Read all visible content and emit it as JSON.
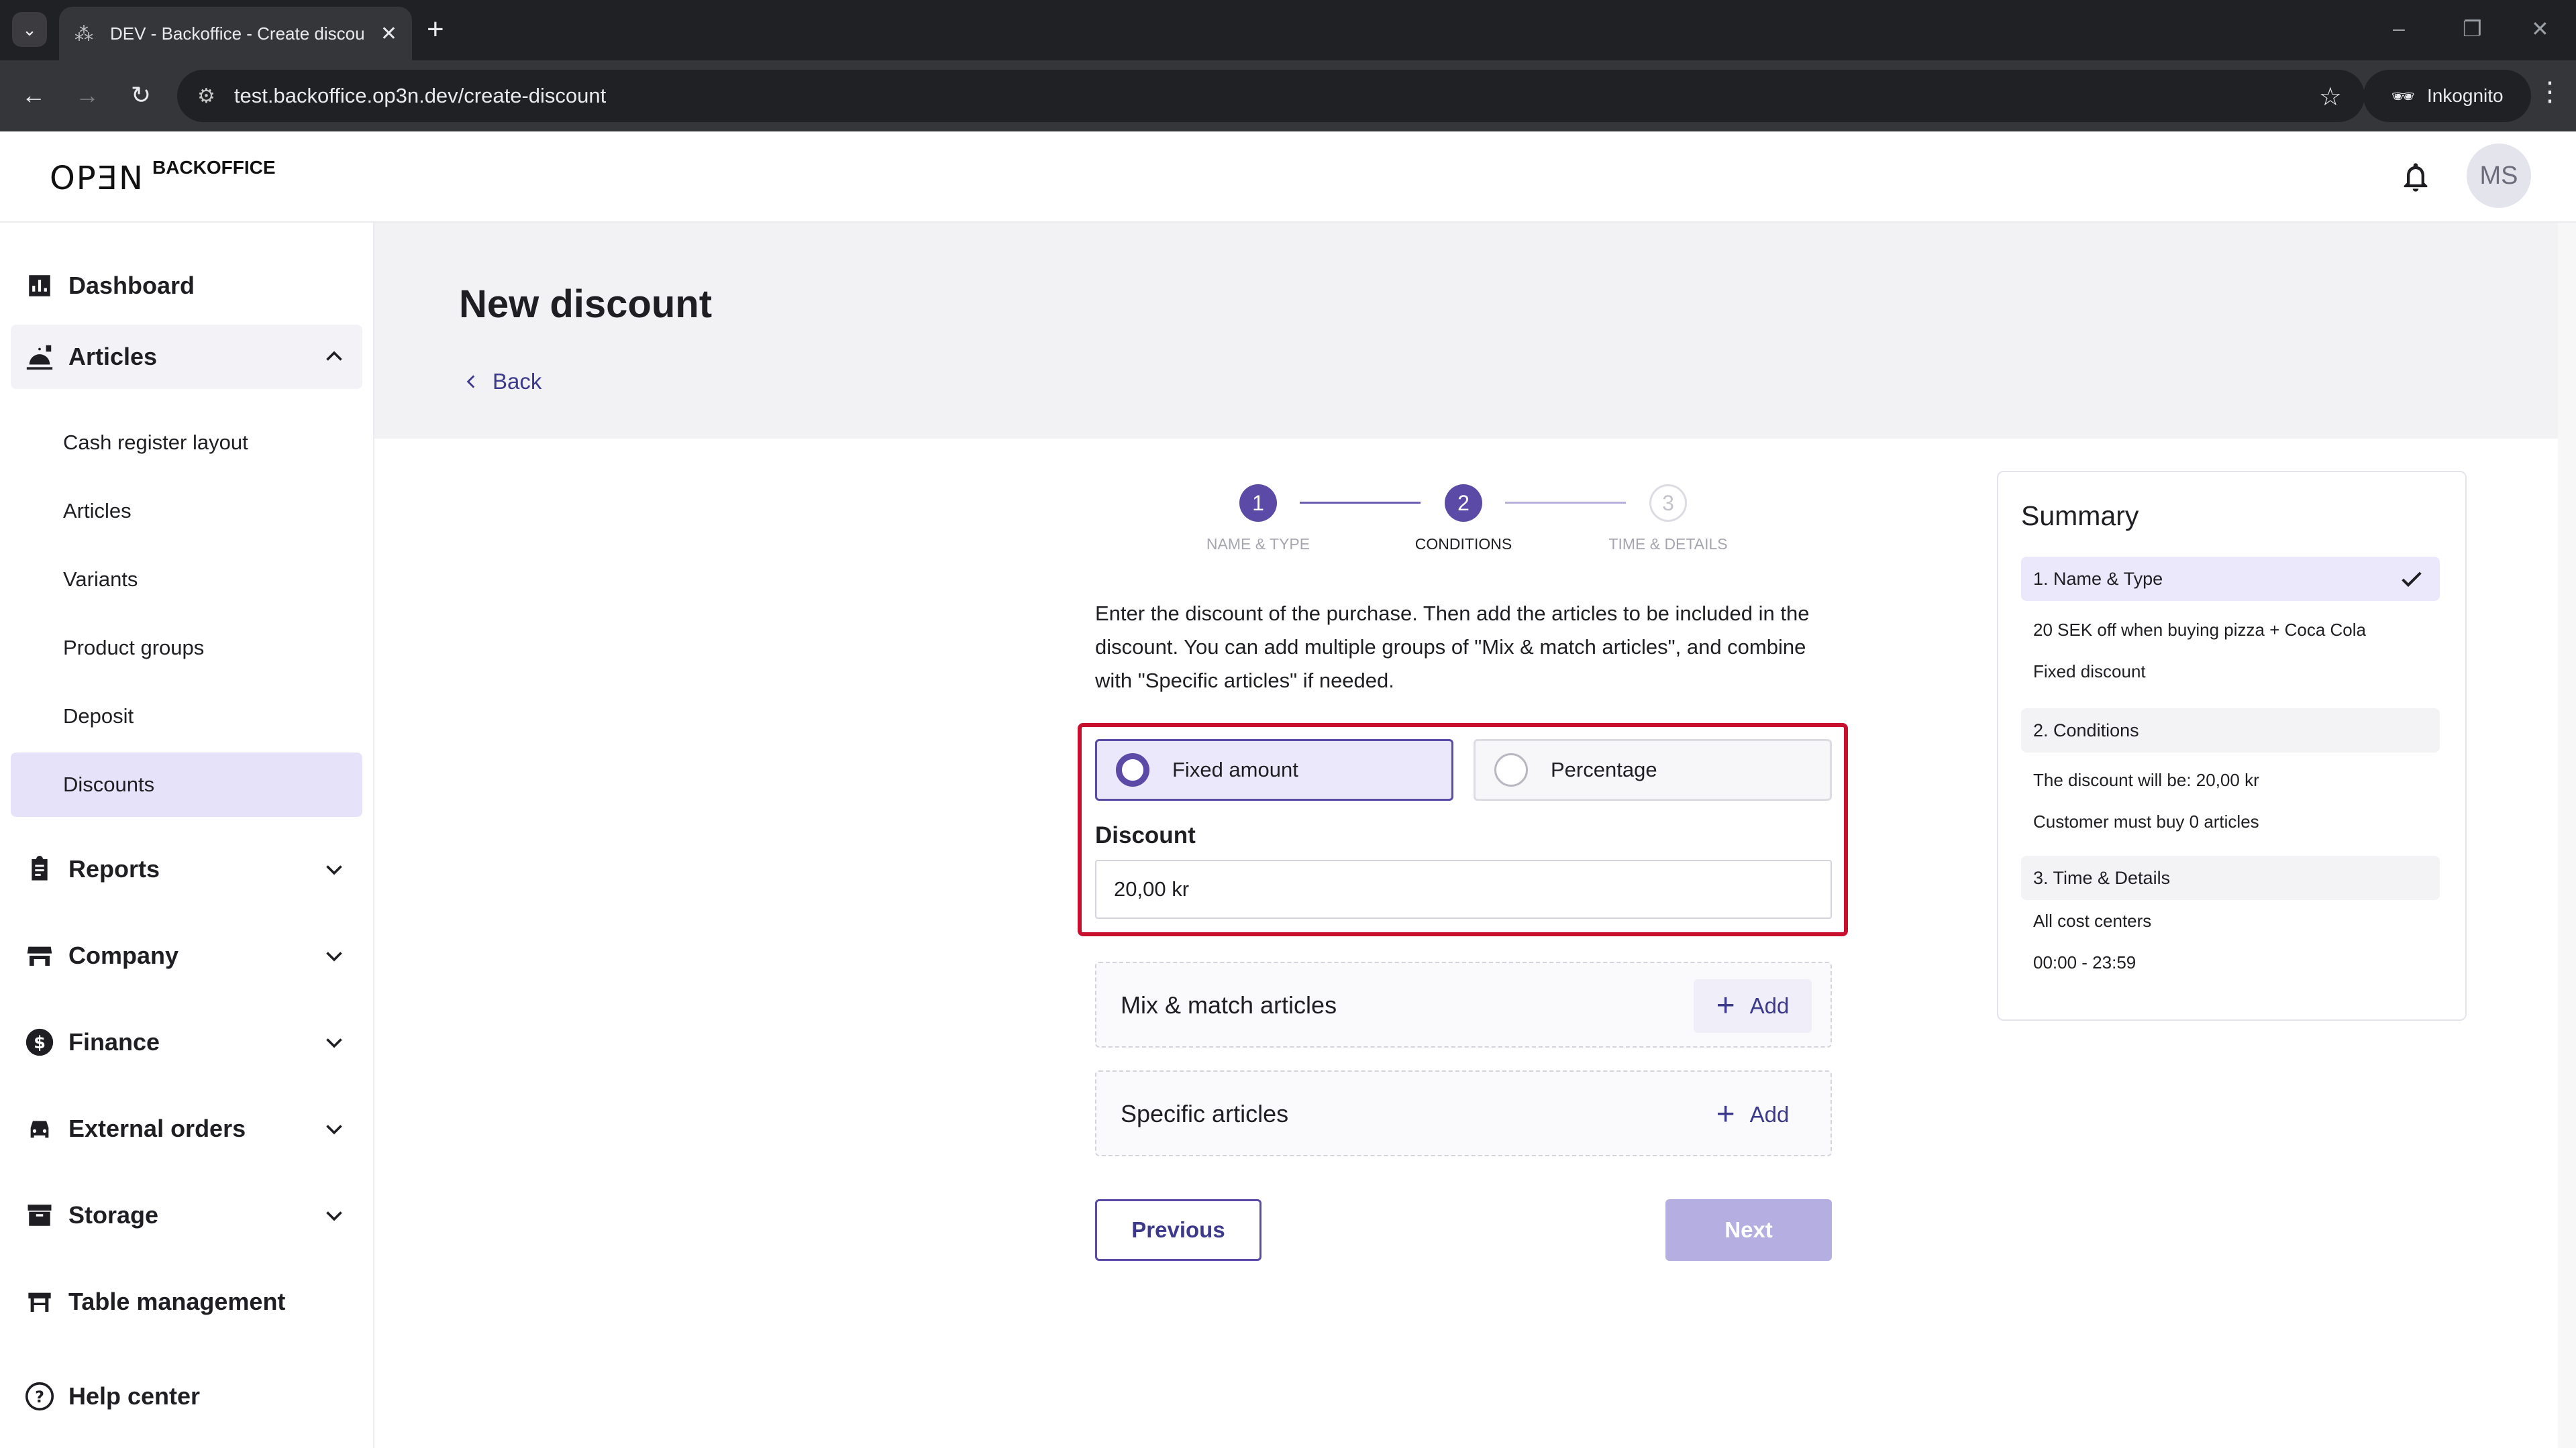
{
  "browser": {
    "tab_title": "DEV - Backoffice - Create discou",
    "url": "test.backoffice.op3n.dev/create-discount",
    "incognito_label": "Inkognito"
  },
  "header": {
    "logo_mark": "OPƎN",
    "logo_text": "BACKOFFICE",
    "avatar_initials": "MS"
  },
  "sidebar": {
    "items": [
      {
        "label": "Dashboard",
        "icon": "bar-chart-icon"
      },
      {
        "label": "Articles",
        "icon": "food-icon"
      },
      {
        "label": "Reports",
        "icon": "clipboard-icon"
      },
      {
        "label": "Company",
        "icon": "store-icon"
      },
      {
        "label": "Finance",
        "icon": "dollar-icon"
      },
      {
        "label": "External orders",
        "icon": "car-icon"
      },
      {
        "label": "Storage",
        "icon": "archive-icon"
      },
      {
        "label": "Table management",
        "icon": "table-icon"
      },
      {
        "label": "Help center",
        "icon": "help-icon"
      }
    ],
    "articles_sub": [
      "Cash register layout",
      "Articles",
      "Variants",
      "Product groups",
      "Deposit",
      "Discounts"
    ]
  },
  "page": {
    "title": "New discount",
    "back_label": "Back"
  },
  "stepper": {
    "steps": [
      {
        "number": "1",
        "label": "NAME & TYPE"
      },
      {
        "number": "2",
        "label": "CONDITIONS"
      },
      {
        "number": "3",
        "label": "TIME & DETAILS"
      }
    ]
  },
  "form": {
    "intro": "Enter the discount of the purchase. Then add the articles to be included in the discount. You can add multiple groups of \"Mix & match articles\", and combine with \"Specific articles\" if needed.",
    "option_fixed": "Fixed amount",
    "option_percentage": "Percentage",
    "discount_label": "Discount",
    "discount_value": "20,00 kr",
    "mix_match_title": "Mix & match articles",
    "specific_title": "Specific articles",
    "add_label": "Add",
    "previous_label": "Previous",
    "next_label": "Next"
  },
  "summary": {
    "title": "Summary",
    "section1_header": "1. Name & Type",
    "section1_lines": [
      "20 SEK off when buying pizza + Coca Cola",
      "Fixed discount"
    ],
    "section2_header": "2. Conditions",
    "section2_lines": [
      "The discount will be: 20,00 kr",
      "Customer must buy 0 articles"
    ],
    "section3_header": "3. Time & Details",
    "section3_lines": [
      "All cost centers",
      "00:00 - 23:59"
    ]
  },
  "colors": {
    "accent": "#5b4aa6",
    "highlight_border": "#c8102e",
    "active_nav_bg": "#e6e2fa"
  }
}
